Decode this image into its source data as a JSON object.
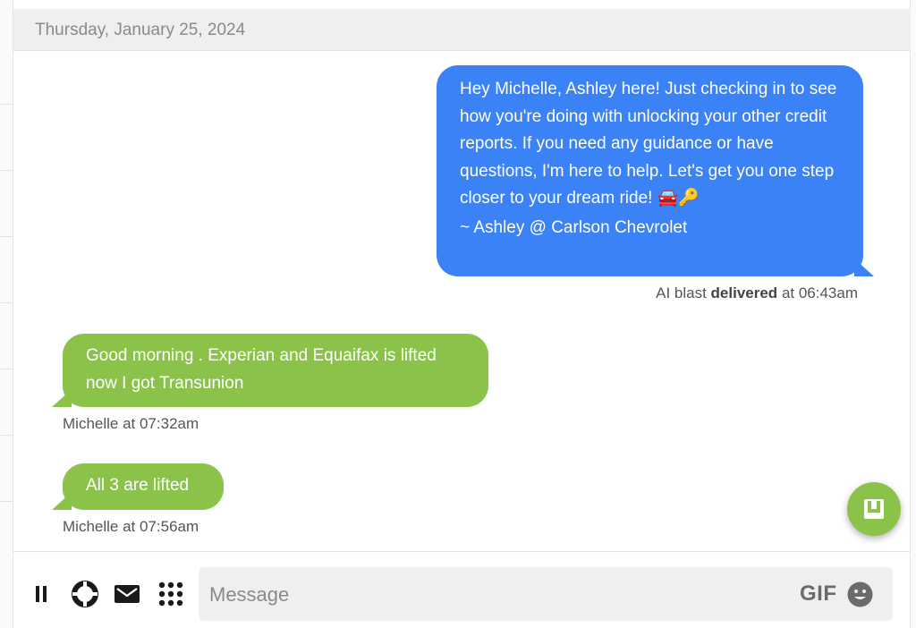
{
  "date_header": "Thursday, January 25, 2024",
  "outgoing": {
    "text": "Hey Michelle, Ashley here! Just checking in to see how you're doing with unlocking your other credit reports. If you need any guidance or have questions, I'm here to help. Let's get you one step closer to your dream ride! 🚘🔑",
    "signature": "~ Ashley @ Carlson Chevrolet",
    "meta_prefix": "AI blast",
    "meta_status": "delivered",
    "meta_suffix": "at 06:43am",
    "color": "#3b82f6"
  },
  "incoming": [
    {
      "text": "Good morning . Experian and Equaifax is lifted now I got Transunion",
      "meta": "Michelle at 07:32am"
    },
    {
      "text": "All 3 are lifted",
      "meta": "Michelle at 07:56am"
    }
  ],
  "incoming_color": "#8bc34a",
  "toolbar": {
    "icons": [
      "pause-icon",
      "lifebuoy-icon",
      "mail-icon",
      "grid-icon"
    ]
  },
  "composer": {
    "placeholder": "Message",
    "value": "",
    "gif_label": "GIF"
  },
  "fab_icon": "inbox-icon"
}
